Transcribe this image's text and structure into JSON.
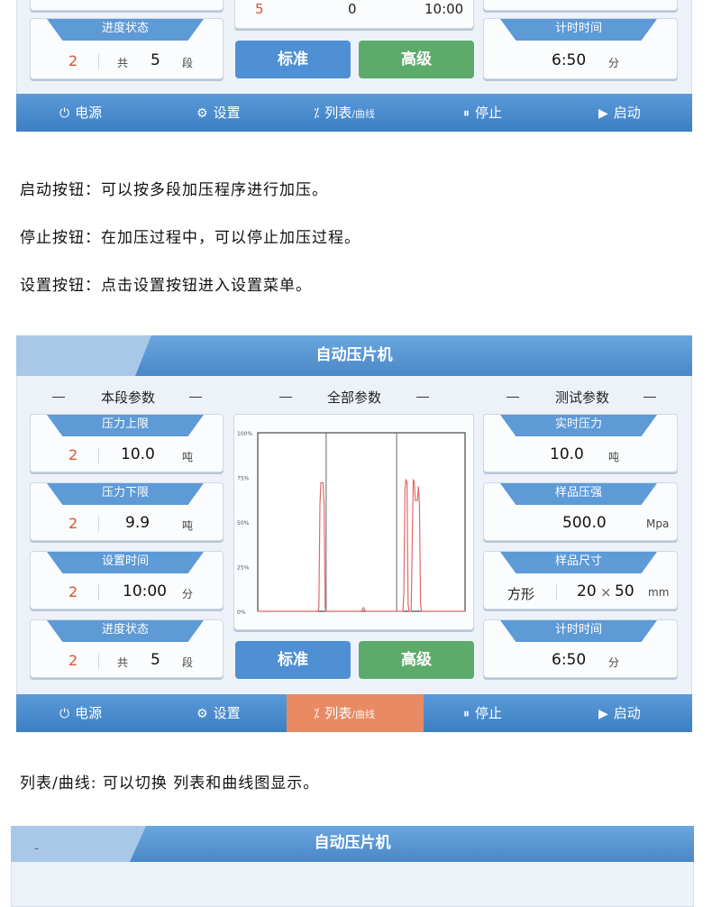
{
  "top_screen": {
    "partial_row": {
      "index": "5",
      "value": "0",
      "time": "10:00"
    },
    "progress_card": {
      "title": "进度状态",
      "index": "2",
      "total_prefix": "共",
      "total": "5",
      "unit": "段"
    },
    "standard_button": "标准",
    "advanced_button": "高级",
    "timer_card": {
      "title": "计时时间",
      "value": "6:50",
      "unit": "分"
    },
    "bottom_bar": [
      {
        "icon": "power-icon",
        "label": "电源",
        "sub": ""
      },
      {
        "icon": "gear-icon",
        "label": "设置",
        "sub": ""
      },
      {
        "icon": "list-curve-icon",
        "label": "列表",
        "sub": "/曲线"
      },
      {
        "icon": "pause-icon",
        "label": "停止",
        "sub": ""
      },
      {
        "icon": "play-icon",
        "label": "启动",
        "sub": ""
      }
    ]
  },
  "descriptions": {
    "start": "启动按钮：可以按多段加压程序进行加压。",
    "stop": "停止按钮：在加压过程中，可以停止加压过程。",
    "settings": "设置按钮：点击设置按钮进入设置菜单。",
    "list_curve": "列表/曲线: 可以切换 列表和曲线图显示。"
  },
  "main_screen": {
    "title": "自动压片机",
    "sections": {
      "segment": "本段参数",
      "all": "全部参数",
      "test": "测试参数"
    },
    "left_cards": [
      {
        "title": "压力上限",
        "index": "2",
        "value": "10.0",
        "unit": "吨"
      },
      {
        "title": "压力下限",
        "index": "2",
        "value": "9.9",
        "unit": "吨"
      },
      {
        "title": "设置时间",
        "index": "2",
        "value": "10:00",
        "unit": "分"
      },
      {
        "title": "进度状态",
        "index": "2",
        "total_prefix": "共",
        "value": "5",
        "unit": "段"
      }
    ],
    "right_cards": [
      {
        "title": "实时压力",
        "value": "10.0",
        "unit": "吨"
      },
      {
        "title": "样品压强",
        "value": "500.0",
        "unit": "Mpa"
      },
      {
        "title": "样品尺寸",
        "shape": "方形",
        "value_a": "20",
        "times": "×",
        "value_b": "50",
        "unit": "mm"
      },
      {
        "title": "计时时间",
        "value": "6:50",
        "unit": "分"
      }
    ],
    "standard_button": "标准",
    "advanced_button": "高级",
    "bottom_bar": [
      {
        "icon": "power-icon",
        "label": "电源",
        "sub": ""
      },
      {
        "icon": "gear-icon",
        "label": "设置",
        "sub": ""
      },
      {
        "icon": "list-curve-icon",
        "label": "列表",
        "sub": "/曲线",
        "active": true
      },
      {
        "icon": "pause-icon",
        "label": "停止",
        "sub": ""
      },
      {
        "icon": "play-icon",
        "label": "启动",
        "sub": ""
      }
    ],
    "accent_color": "#e88a62"
  },
  "chart_data": {
    "type": "line",
    "y_tick_labels": [
      "100%",
      "75%",
      "50%",
      "25%",
      "0%"
    ],
    "ylim": [
      0,
      100
    ],
    "xlim": [
      0,
      100
    ],
    "vertical_markers": [
      33,
      67
    ],
    "series": [
      {
        "color": "#e06a6a",
        "points": [
          [
            0,
            0
          ],
          [
            29,
            0
          ],
          [
            29.5,
            2
          ],
          [
            30,
            60
          ],
          [
            30.5,
            72
          ],
          [
            31.5,
            72
          ],
          [
            32,
            60
          ],
          [
            32.5,
            2
          ],
          [
            33,
            0
          ],
          [
            50,
            0
          ],
          [
            51,
            2
          ],
          [
            52,
            0
          ],
          [
            70,
            0
          ],
          [
            70.5,
            10
          ],
          [
            71,
            68
          ],
          [
            71.5,
            74
          ],
          [
            72,
            72
          ],
          [
            72.5,
            4
          ],
          [
            73,
            0
          ],
          [
            74,
            0
          ],
          [
            74.5,
            36
          ],
          [
            75,
            74
          ],
          [
            75.5,
            72
          ],
          [
            76,
            62
          ],
          [
            77,
            62
          ],
          [
            77.5,
            70
          ],
          [
            78,
            60
          ],
          [
            78.5,
            4
          ],
          [
            79,
            0
          ],
          [
            100,
            0
          ]
        ]
      }
    ]
  },
  "bottom_screen": {
    "title": "自动压片机",
    "partial_text": "–"
  }
}
